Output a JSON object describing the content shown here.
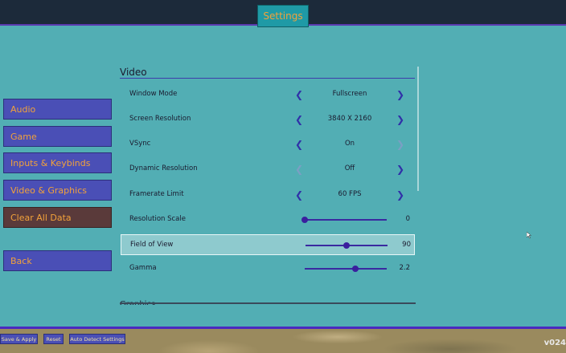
{
  "header": {
    "title": "Settings"
  },
  "sidebar": {
    "items": [
      {
        "label": "Audio"
      },
      {
        "label": "Game"
      },
      {
        "label": "Inputs & Keybinds"
      },
      {
        "label": "Video & Graphics"
      },
      {
        "label": "Clear All Data"
      },
      {
        "label": "Back"
      }
    ]
  },
  "video": {
    "section_title": "Video",
    "options": [
      {
        "label": "Window Mode",
        "value": "Fullscreen"
      },
      {
        "label": "Screen Resolution",
        "value": "3840 X 2160"
      },
      {
        "label": "VSync",
        "value": "On"
      },
      {
        "label": "Dynamic Resolution",
        "value": "Off"
      },
      {
        "label": "Framerate Limit",
        "value": "60 FPS"
      }
    ],
    "sliders": [
      {
        "label": "Resolution Scale",
        "value": "0",
        "level": 0.0
      },
      {
        "label": "Field of View",
        "value": "90",
        "level": 0.5
      },
      {
        "label": "Gamma",
        "value": "2.2",
        "level": 0.62
      }
    ]
  },
  "next_section_title": "Graphics",
  "footer": {
    "save_label": "Save & Apply",
    "reset_label": "Reset",
    "auto_detect_label": "Auto Detect Settings",
    "version": "v024"
  },
  "colors": {
    "background": "#52aeb4",
    "button": "#4a4fb6",
    "button_text": "#f2a23a",
    "danger_button": "#5a3a3a",
    "accent": "#3a1f9e"
  },
  "icons": {
    "left_arrow": "chevron-left-icon",
    "right_arrow": "chevron-right-icon"
  }
}
